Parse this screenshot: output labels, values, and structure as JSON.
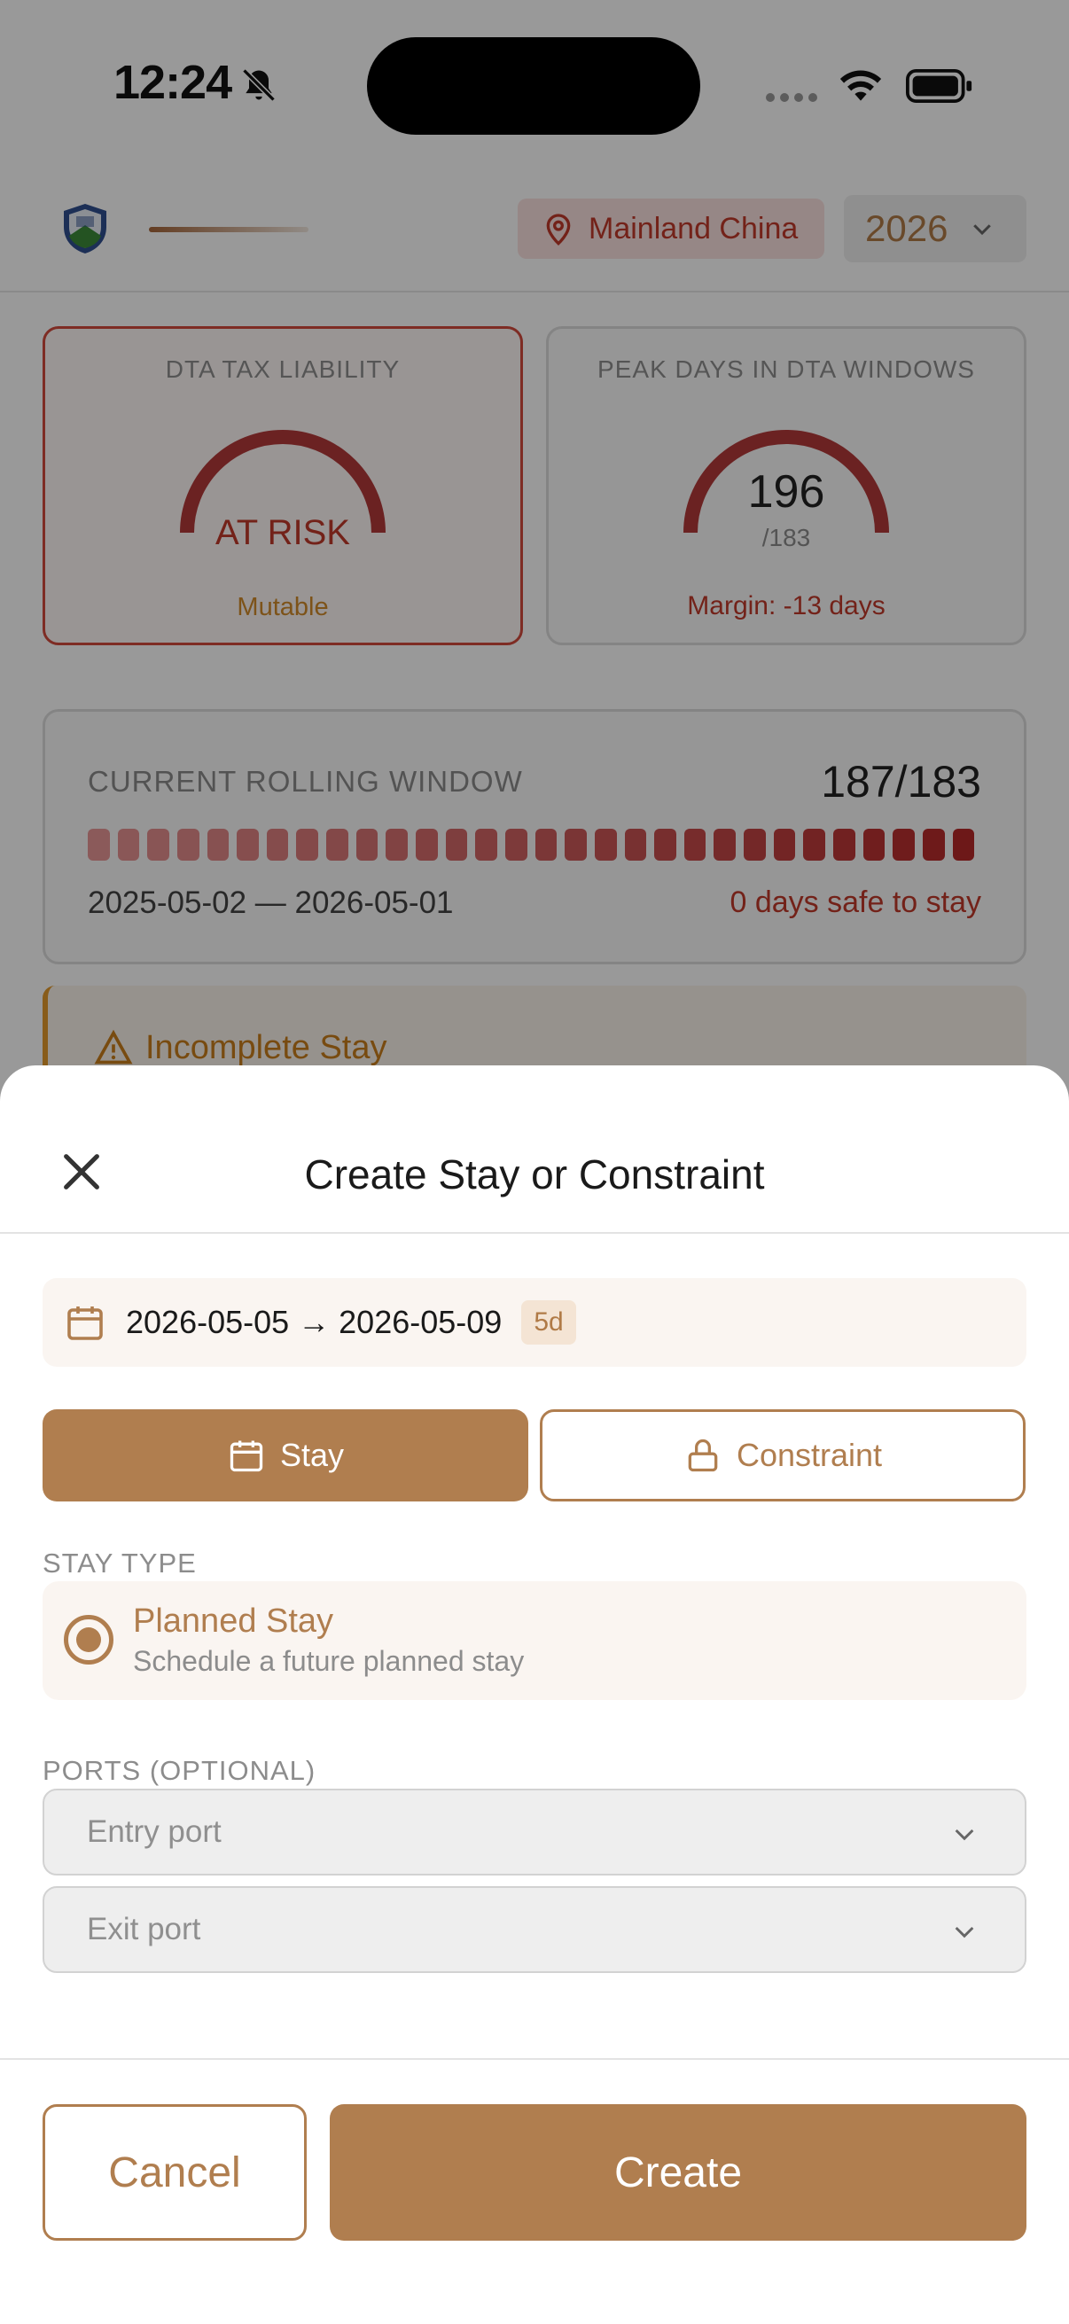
{
  "status_bar": {
    "time": "12:24"
  },
  "header": {
    "location": "Mainland China",
    "year": "2026"
  },
  "cards": {
    "tax": {
      "label": "DTA TAX LIABILITY",
      "value": "AT RISK",
      "foot": "Mutable"
    },
    "peak": {
      "label": "PEAK DAYS IN DTA WINDOWS",
      "value": "196",
      "limit": "/183",
      "foot": "Margin: -13 days"
    }
  },
  "rolling": {
    "title": "CURRENT ROLLING WINDOW",
    "count": "187/183",
    "range": "2025-05-02 — 2026-05-01",
    "safe": "0 days safe to stay",
    "segments": 30
  },
  "warning": {
    "title": "Incomplete Stay"
  },
  "sheet": {
    "title": "Create Stay or Constraint",
    "date_range": "2026-05-05 → 2026-05-09",
    "duration": "5d",
    "tabs": {
      "stay": "Stay",
      "constraint": "Constraint"
    },
    "stay_type_label": "STAY TYPE",
    "option_title": "Planned Stay",
    "option_sub": "Schedule a future planned stay",
    "ports_label": "PORTS (OPTIONAL)",
    "entry_placeholder": "Entry port",
    "exit_placeholder": "Exit port",
    "cancel": "Cancel",
    "create": "Create"
  },
  "colors": {
    "accent": "#b07e4f",
    "risk": "#c0392b",
    "warning": "#e39a2c"
  }
}
